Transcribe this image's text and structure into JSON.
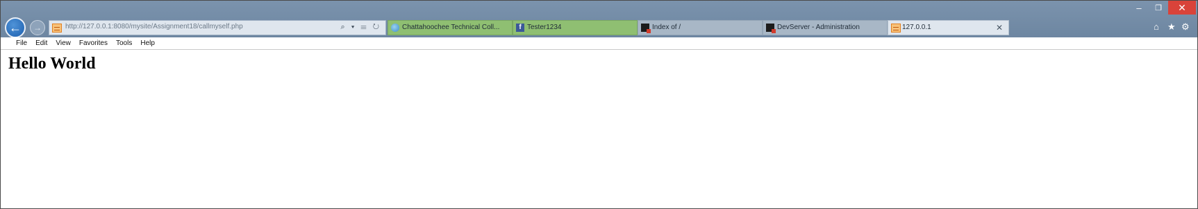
{
  "window": {
    "minimize_glyph": "–",
    "maximize_glyph": "❐",
    "close_glyph": "✕"
  },
  "nav": {
    "back_icon": "back-arrow-icon",
    "forward_icon": "forward-arrow-icon",
    "back_glyph": "←",
    "forward_glyph": "→"
  },
  "address_bar": {
    "url": "http://127.0.0.1:8080/mysite/Assignment18/callmyself.php",
    "icons": "⌕ ▾ ☰ ↻"
  },
  "tabs": [
    {
      "label": "Chattahoochee Technical Coll...",
      "icon": "globe-icon",
      "active": false
    },
    {
      "label": "Tester1234",
      "icon": "facebook-icon",
      "active": false
    },
    {
      "label": "Index of /",
      "icon": "server-icon",
      "active": false
    },
    {
      "label": "DevServer - Administration",
      "icon": "server-icon",
      "active": false
    },
    {
      "label": "127.0.0.1",
      "icon": "page-icon",
      "active": true,
      "close_glyph": "✕"
    }
  ],
  "toolbar_icons": {
    "home": "⌂",
    "favorites": "★",
    "settings": "⚙"
  },
  "menu": {
    "items": [
      "File",
      "Edit",
      "View",
      "Favorites",
      "Tools",
      "Help"
    ]
  },
  "page": {
    "heading": "Hello World"
  },
  "colors": {
    "titlebar": "#6d86a1",
    "close_button": "#d9433a",
    "pinned_tab": "#8fbf72",
    "active_tab": "#dfe6ee"
  }
}
